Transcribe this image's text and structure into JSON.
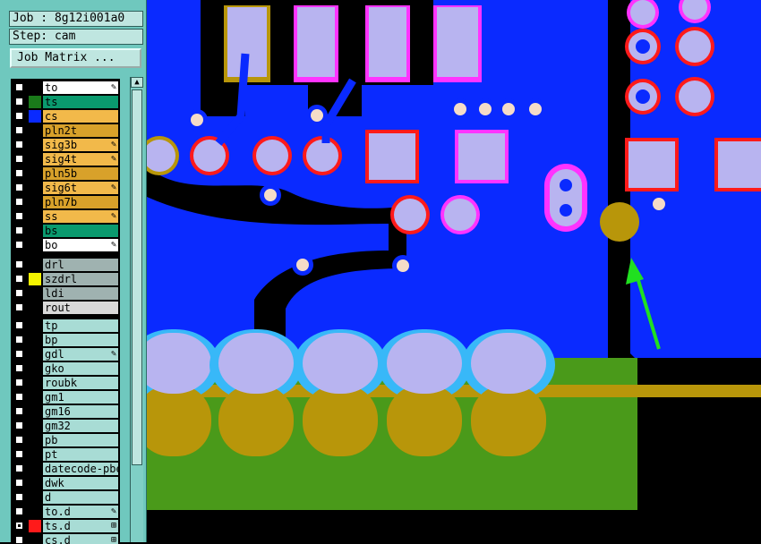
{
  "panel": {
    "job_label": "Job : 8g12i001a0",
    "step_label": "Step: cam",
    "job_matrix_button": "Job Matrix ...",
    "scroll_up_glyph": "▲"
  },
  "layer_groups": [
    [
      {
        "name": "to",
        "color": "#ffffff",
        "swatch": "#000000",
        "mark": "✎"
      },
      {
        "name": "ts",
        "color": "#0a9a6e",
        "swatch": "#1a7a1a",
        "mark": ""
      },
      {
        "name": "cs",
        "color": "#f2b94a",
        "swatch": "#0a2aff",
        "mark": ""
      },
      {
        "name": "pln2t",
        "color": "#d8a12a",
        "swatch": "#000000",
        "mark": ""
      },
      {
        "name": "sig3b",
        "color": "#f2b94a",
        "swatch": "#000000",
        "mark": "✎"
      },
      {
        "name": "sig4t",
        "color": "#f2b94a",
        "swatch": "#000000",
        "mark": "✎"
      },
      {
        "name": "pln5b",
        "color": "#d8a12a",
        "swatch": "#000000",
        "mark": ""
      },
      {
        "name": "sig6t",
        "color": "#f2b94a",
        "swatch": "#000000",
        "mark": "✎"
      },
      {
        "name": "pln7b",
        "color": "#d8a12a",
        "swatch": "#000000",
        "mark": ""
      },
      {
        "name": "ss",
        "color": "#f2b94a",
        "swatch": "#000000",
        "mark": "✎"
      },
      {
        "name": "bs",
        "color": "#0a9a6e",
        "swatch": "#000000",
        "mark": ""
      },
      {
        "name": "bo",
        "color": "#ffffff",
        "swatch": "#000000",
        "mark": "✎"
      }
    ],
    [
      {
        "name": "drl",
        "color": "#9fb2b0",
        "swatch": "#000000",
        "mark": ""
      },
      {
        "name": "szdrl",
        "color": "#9fb2b0",
        "swatch": "#f4f400",
        "mark": ""
      },
      {
        "name": "ldi",
        "color": "#9fb2b0",
        "swatch": "#000000",
        "mark": ""
      },
      {
        "name": "rout",
        "color": "#d9d9d9",
        "swatch": "#000000",
        "mark": ""
      }
    ],
    [
      {
        "name": "tp",
        "color": "#a8dcd5",
        "swatch": "#000000",
        "mark": ""
      },
      {
        "name": "bp",
        "color": "#a8dcd5",
        "swatch": "#000000",
        "mark": ""
      },
      {
        "name": "gdl",
        "color": "#a8dcd5",
        "swatch": "#000000",
        "mark": "✎"
      },
      {
        "name": "gko",
        "color": "#a8dcd5",
        "swatch": "#000000",
        "mark": ""
      },
      {
        "name": "roubk",
        "color": "#a8dcd5",
        "swatch": "#000000",
        "mark": ""
      },
      {
        "name": "gm1",
        "color": "#a8dcd5",
        "swatch": "#000000",
        "mark": ""
      },
      {
        "name": "gm16",
        "color": "#a8dcd5",
        "swatch": "#000000",
        "mark": ""
      },
      {
        "name": "gm32",
        "color": "#a8dcd5",
        "swatch": "#000000",
        "mark": ""
      },
      {
        "name": "pb",
        "color": "#a8dcd5",
        "swatch": "#000000",
        "mark": ""
      },
      {
        "name": "pt",
        "color": "#a8dcd5",
        "swatch": "#000000",
        "mark": ""
      },
      {
        "name": "datecode-pbe",
        "color": "#a8dcd5",
        "swatch": "#000000",
        "mark": ""
      },
      {
        "name": "dwk",
        "color": "#a8dcd5",
        "swatch": "#000000",
        "mark": ""
      },
      {
        "name": "d",
        "color": "#a8dcd5",
        "swatch": "#000000",
        "mark": ""
      },
      {
        "name": "to.d",
        "color": "#a8dcd5",
        "swatch": "#000000",
        "mark": "✎"
      },
      {
        "name": "ts.d",
        "color": "#a8dcd5",
        "swatch": "#ff1a1a",
        "mark": "⊞",
        "checked": true
      },
      {
        "name": "cs.d",
        "color": "#a8dcd5",
        "swatch": "#000000",
        "mark": "⊞"
      }
    ]
  ],
  "colors": {
    "panel_bg": "#6fc8be",
    "copper_blue": "#0a2aff",
    "pad_fill": "#b8b4f0",
    "pad_ring_red": "#ff1a1a",
    "pad_ring_magenta": "#ff33ff",
    "gold": "#b8960a",
    "green": "#4a9a1a",
    "cyan_mask": "#38b8f8",
    "arrow_green": "#20e020"
  }
}
